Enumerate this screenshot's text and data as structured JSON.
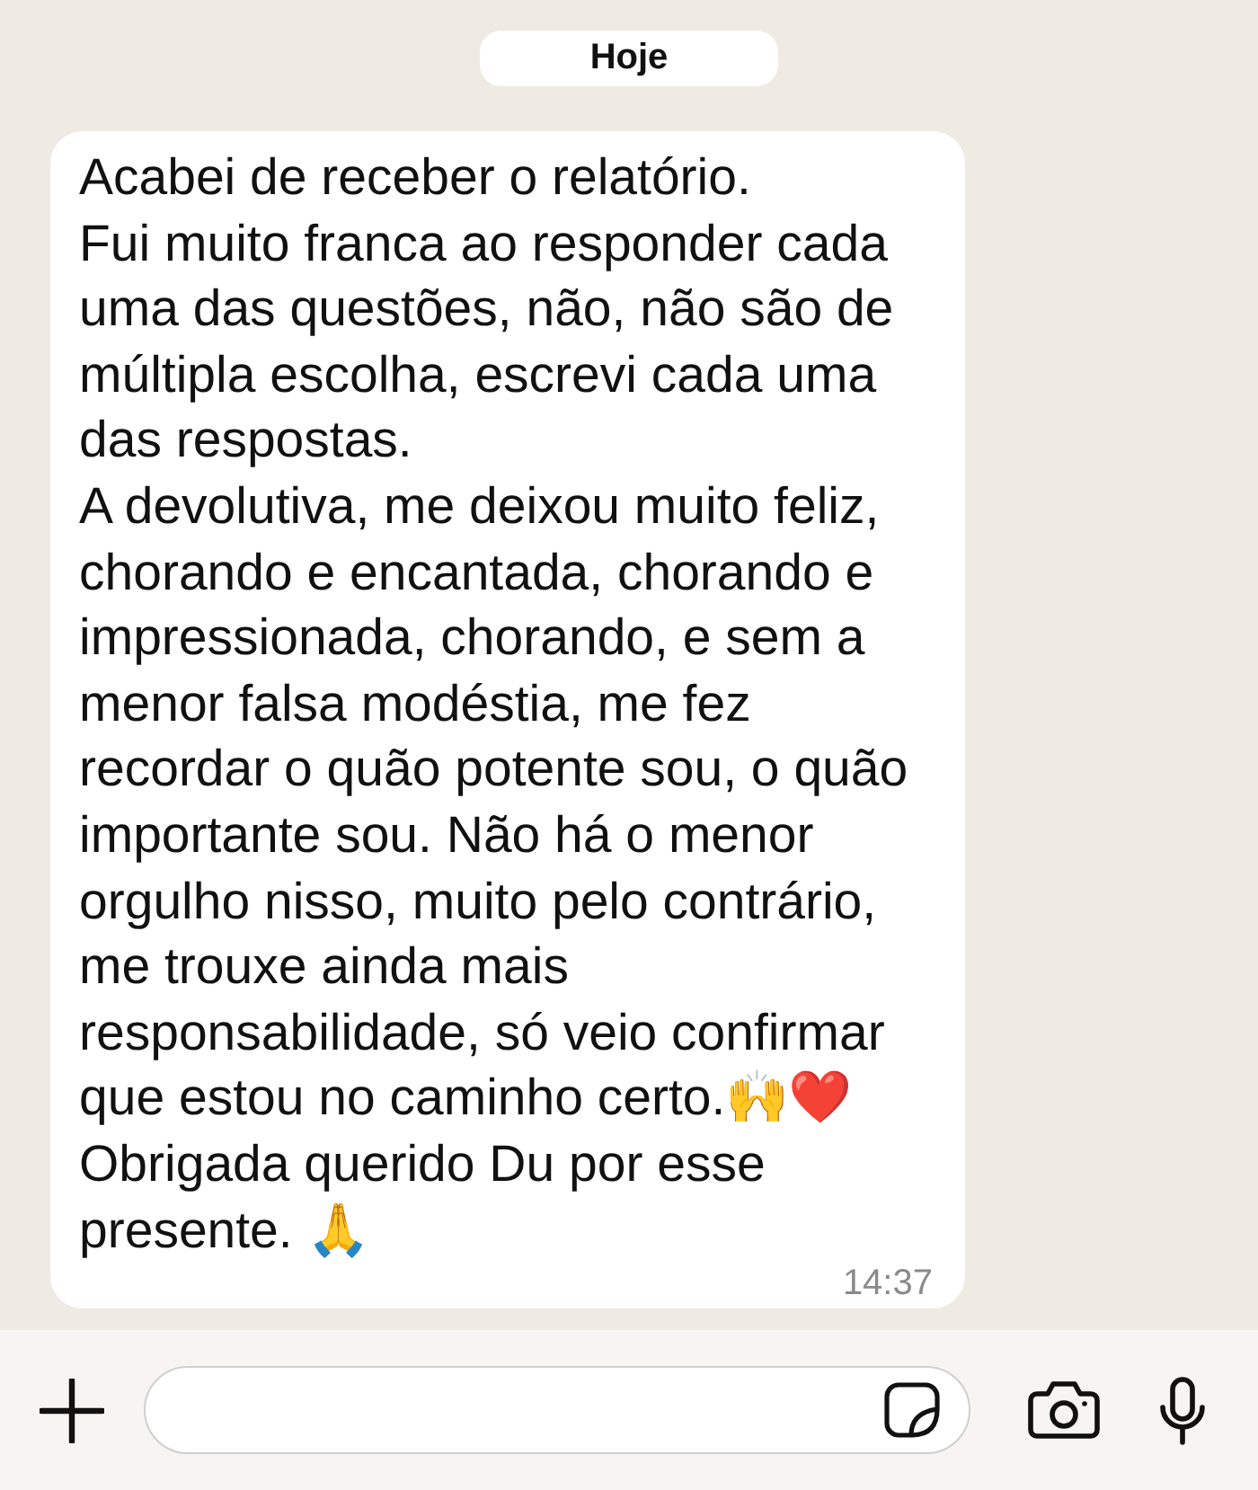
{
  "date_badge": {
    "text": "Hoje"
  },
  "message": {
    "lines": [
      "Acabei de receber o relatório.",
      "Fui muito franca ao responder cada",
      "uma das questões, não, não são de",
      "múltipla escolha, escrevi cada uma",
      "das respostas.",
      "A devolutiva, me deixou muito feliz,",
      "chorando e encantada, chorando e",
      "impressionada, chorando, e sem a",
      "menor falsa modéstia, me fez",
      "recordar o quão potente sou, o quão",
      "importante sou. Não há o menor",
      "orgulho nisso, muito pelo contrário,",
      "me trouxe ainda mais",
      "responsabilidade, só veio confirmar",
      "que estou no caminho certo.🙌❤️",
      "Obrigada querido Du por esse",
      "presente. 🙏"
    ],
    "time": "14:37"
  }
}
